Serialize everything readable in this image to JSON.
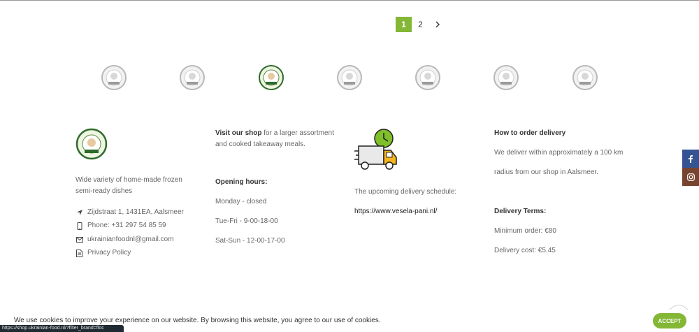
{
  "pagination": {
    "pages": [
      "1",
      "2"
    ],
    "active": "1",
    "next_icon": "chevron-right-icon"
  },
  "brands": {
    "count": 7,
    "highlighted_index": 2,
    "icon": "brand-logo"
  },
  "footer": {
    "col1": {
      "description": "Wide variety of home-made frozen semi-ready dishes",
      "address": "Zijdstraat 1, 1431EA, Aalsmeer",
      "phone": "Phone: +31 297 54 85 59",
      "email": "ukrainianfoodnl@gmail.com",
      "privacy": "Privacy Policy"
    },
    "col2": {
      "visit_strong": "Visit our shop",
      "visit_rest": " for a larger assortment and cooked takeaway meals.",
      "hours_title": "Opening hours:",
      "hours": [
        "Monday - closed",
        "Tue-Fri - 9-00-18-00",
        "Sat-Sun - 12-00-17-00"
      ]
    },
    "col3": {
      "schedule_text": "The upcoming delivery schedule:",
      "schedule_link": "https://www.vesela-pani.nl/"
    },
    "col4": {
      "order_title": "How to order delivery",
      "order_text_1": "We deliver within approximately a 100 km",
      "order_text_2": "radius from our shop in Aalsmeer.",
      "terms_title": "Delivery Terms:",
      "min_order": "Minimum order: €80",
      "delivery_cost": "Delivery cost: €5.45"
    }
  },
  "cookie": {
    "text": "We use cookies to improve your experience on our website. By browsing this website, you agree to our use of cookies.",
    "accept": "ACCEPT"
  },
  "status_bar": {
    "url": "https://shop.ukrainian-food.nl/?filter_brand=floc"
  },
  "colors": {
    "accent": "#83b735",
    "facebook": "#365493",
    "instagram": "#774430"
  }
}
